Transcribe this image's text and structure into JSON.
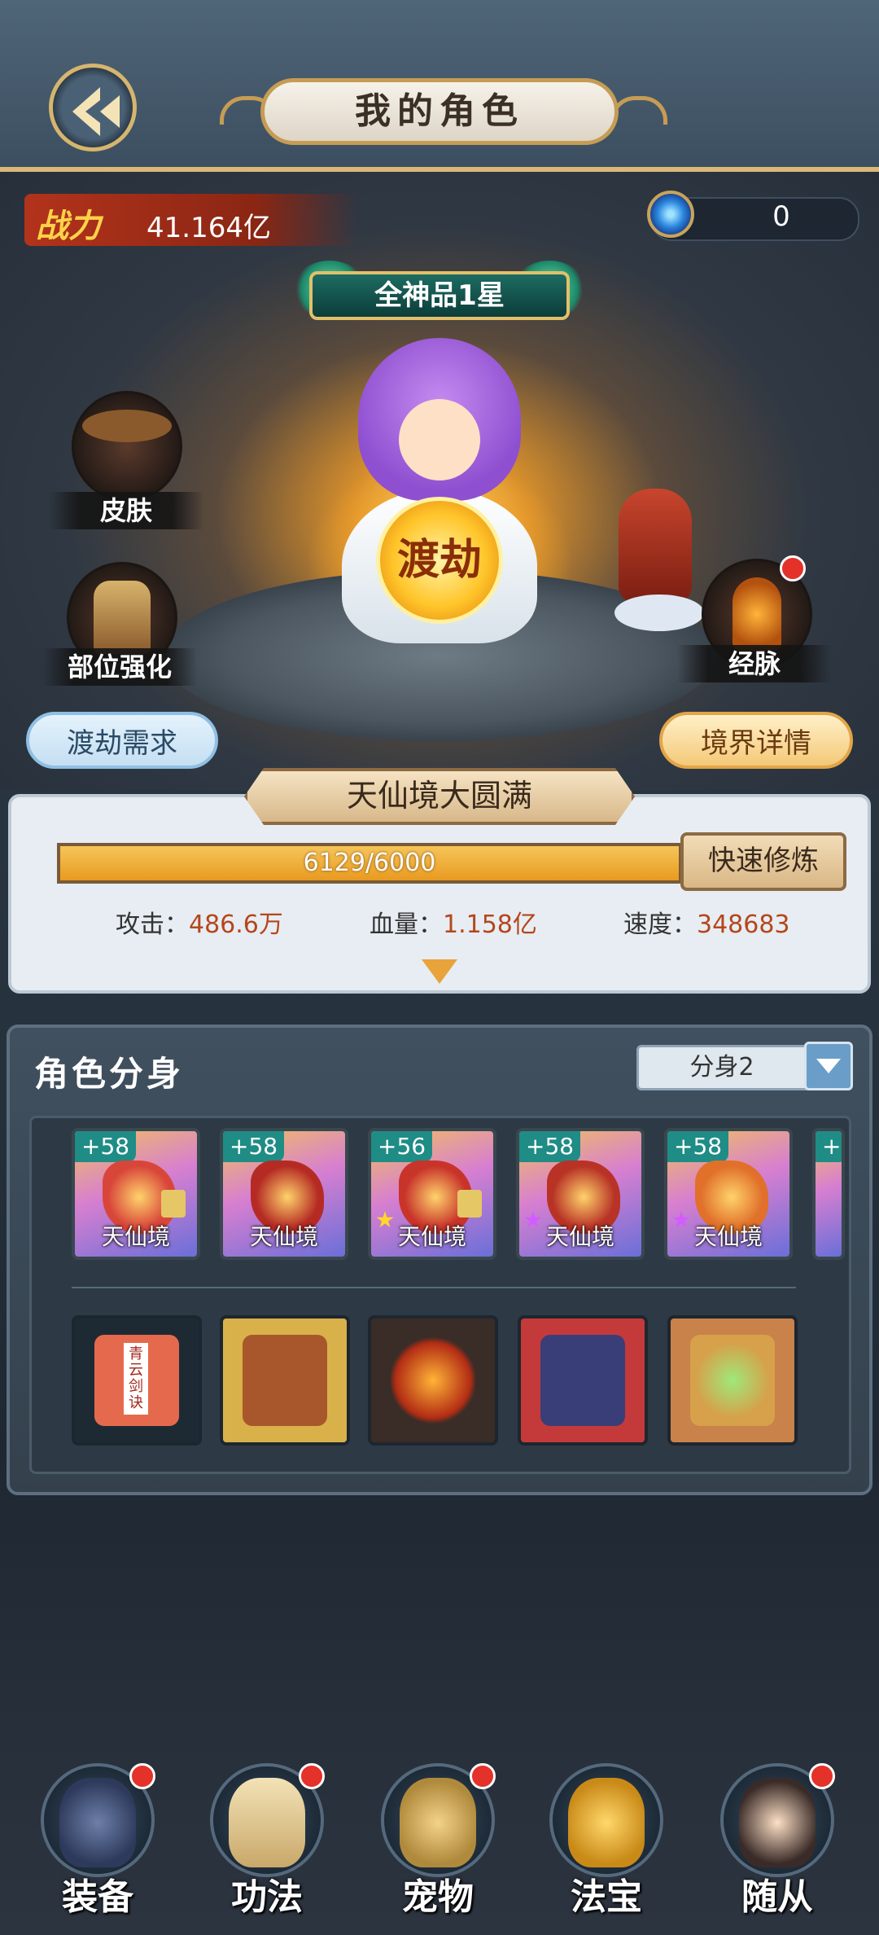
{
  "header": {
    "title": "我的角色"
  },
  "status": {
    "power_label": "战力",
    "power_value": "41.164亿",
    "currency_value": "0"
  },
  "hero": {
    "rank": "全神品1星",
    "action": "渡劫"
  },
  "side_buttons": {
    "skin": "皮肤",
    "part_enhance": "部位强化",
    "meridian": "经脉"
  },
  "actions": {
    "dujie_requirements": "渡劫需求",
    "realm_details": "境界详情"
  },
  "realm": {
    "name": "天仙境大圆满",
    "exp_text": "6129/6000",
    "exp_progress": 1.0,
    "fast_train": "快速修炼",
    "stats": [
      {
        "label": "攻击：",
        "value": "486.6万"
      },
      {
        "label": "血量：",
        "value": "1.158亿"
      },
      {
        "label": "速度：",
        "value": "348683"
      }
    ]
  },
  "clone": {
    "title": "角色分身",
    "selected": "分身2",
    "equipment": [
      {
        "level": "+58",
        "realm": "天仙境",
        "icon": "sword-icon",
        "locked": true,
        "star": ""
      },
      {
        "level": "+58",
        "realm": "天仙境",
        "icon": "armor-icon",
        "locked": false,
        "star": ""
      },
      {
        "level": "+56",
        "realm": "天仙境",
        "icon": "helmet-icon",
        "locked": true,
        "star": "purple-yellow"
      },
      {
        "level": "+58",
        "realm": "天仙境",
        "icon": "boots-icon",
        "locked": false,
        "star": "purple"
      },
      {
        "level": "+58",
        "realm": "天仙境",
        "icon": "necklace-icon",
        "locked": false,
        "star": "purple"
      },
      {
        "level": "+",
        "realm": "",
        "icon": "partial-item-icon",
        "locked": false,
        "star": ""
      }
    ],
    "slots": [
      {
        "icon": "manual-book-icon",
        "book_title": "青云剑诀"
      },
      {
        "icon": "monkey-king-icon"
      },
      {
        "icon": "flame-blade-icon"
      },
      {
        "icon": "armored-general-icon"
      },
      {
        "icon": "jade-bowl-icon"
      }
    ]
  },
  "nav": [
    {
      "label": "装备",
      "icon": "equipment-icon",
      "badge": true
    },
    {
      "label": "功法",
      "icon": "scroll-book-icon",
      "badge": true
    },
    {
      "label": "宠物",
      "icon": "pet-dragon-icon",
      "badge": true
    },
    {
      "label": "法宝",
      "icon": "treasure-bell-icon",
      "badge": false
    },
    {
      "label": "随从",
      "icon": "follower-icon",
      "badge": true
    }
  ],
  "colors": {
    "accent_gold": "#d9b878",
    "exp_bar": "#f0b340",
    "stat_value": "#b5461c",
    "badge_red": "#e4312a"
  }
}
